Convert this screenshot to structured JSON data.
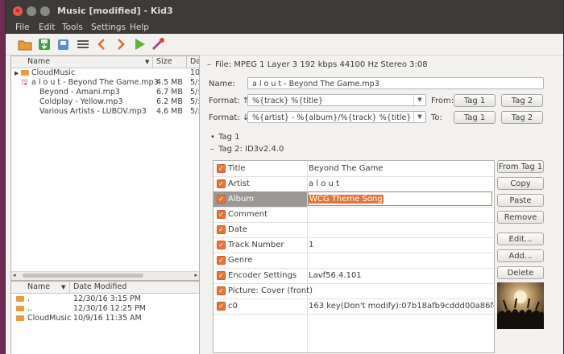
{
  "window": {
    "title": "Music [modified] - Kid3"
  },
  "menu": [
    "File",
    "Edit",
    "Tools",
    "Settings",
    "Help"
  ],
  "file_list": {
    "headers": {
      "name": "Name",
      "size": "Size",
      "date": "Da"
    },
    "rows": [
      {
        "name": "CloudMusic",
        "size": "",
        "date": "10",
        "kind": "folder"
      },
      {
        "name": "a l o u t - Beyond The Game.mp3",
        "size": "4.5 MB",
        "date": "5/:",
        "kind": "modified"
      },
      {
        "name": "Beyond - Amani.mp3",
        "size": "6.7 MB",
        "date": "5/:",
        "kind": "file"
      },
      {
        "name": "Coldplay - Yellow.mp3",
        "size": "6.2 MB",
        "date": "5/:",
        "kind": "file"
      },
      {
        "name": "Various Artists - LUBOV.mp3",
        "size": "4.6 MB",
        "date": "5/:",
        "kind": "file"
      }
    ]
  },
  "dir_list": {
    "headers": {
      "name": "Name",
      "date": "Date Modified"
    },
    "rows": [
      {
        "name": ".",
        "date": "12/30/16 3:15 PM"
      },
      {
        "name": "..",
        "date": "12/30/16 12:25 PM"
      },
      {
        "name": "CloudMusic",
        "date": "10/9/16 11:35 AM"
      }
    ]
  },
  "file_info": "File: MPEG 1 Layer 3 192 kbps 44100 Hz Stereo 3:08",
  "name_field": {
    "label": "Name:",
    "value": "a l o u t - Beyond The Game.mp3"
  },
  "format_up": {
    "label": "Format: ↑",
    "value": "%{track} %{title}",
    "from_label": "From:",
    "tag1": "Tag 1",
    "tag2": "Tag 2"
  },
  "format_down": {
    "label": "Format: ↓",
    "value": "%{artist} - %{album}/%{track} %{title}",
    "to_label": "To:",
    "tag1": "Tag 1",
    "tag2": "Tag 2"
  },
  "tag1_label": "Tag 1",
  "tag2_label": "Tag 2: ID3v2.4.0",
  "tags": [
    {
      "name": "Title",
      "value": "Beyond The Game"
    },
    {
      "name": "Artist",
      "value": "a l o u t"
    },
    {
      "name": "Album",
      "value": "WCG Theme Song",
      "selected": true
    },
    {
      "name": "Comment",
      "value": ""
    },
    {
      "name": "Date",
      "value": ""
    },
    {
      "name": "Track Number",
      "value": "1"
    },
    {
      "name": "Genre",
      "value": ""
    },
    {
      "name": "Encoder Settings",
      "value": "Lavf56.4.101"
    },
    {
      "name": "Picture: Cover (front)",
      "value": ""
    },
    {
      "name": "c0",
      "value": "163 key(Don't modify):07b18afb9cddd00a86fc6..."
    }
  ],
  "side_buttons": [
    "From Tag 1",
    "Copy",
    "Paste",
    "Remove",
    "Edit...",
    "Add...",
    "Delete"
  ],
  "colors": {
    "accent": "#e7743a",
    "titlebar": "#3c3b37",
    "selection": "#9a9896"
  }
}
